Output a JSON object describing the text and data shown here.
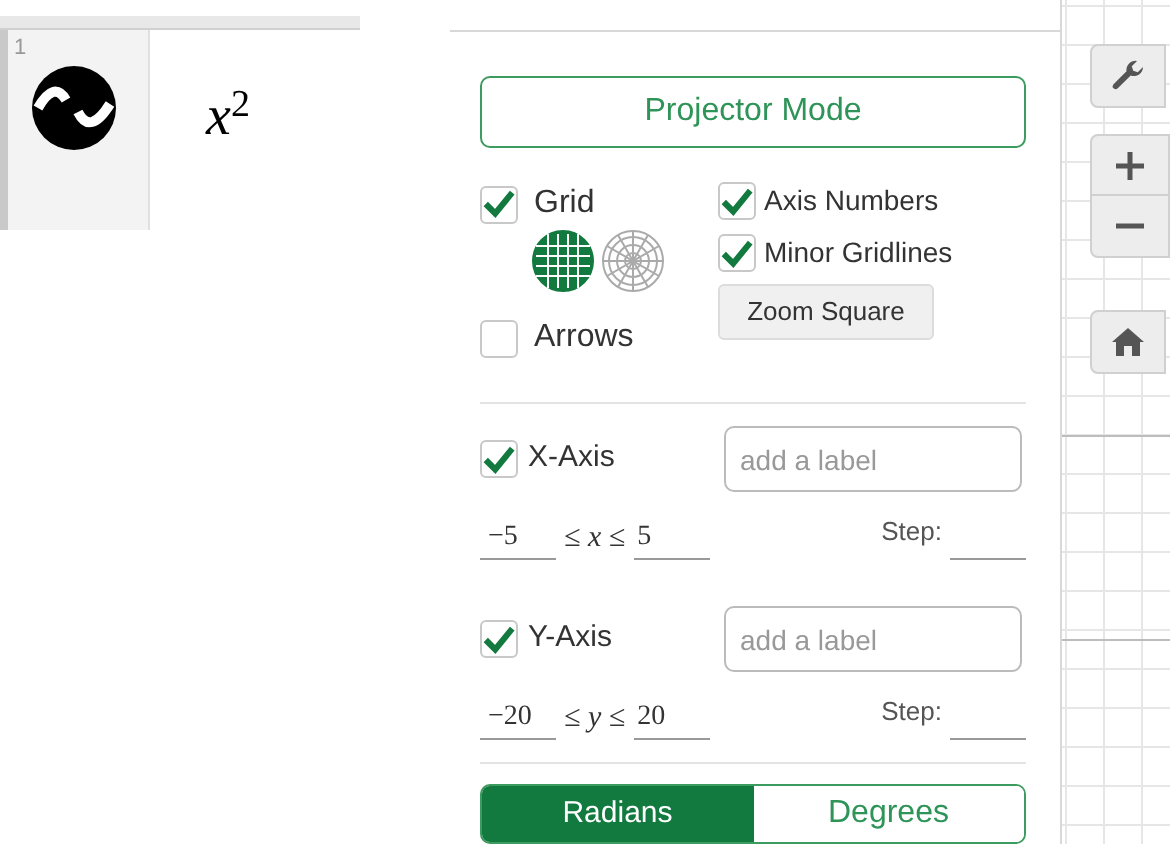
{
  "expression_list": {
    "rows": [
      {
        "index": "1",
        "expression": "x",
        "exponent": "2"
      }
    ]
  },
  "settings": {
    "projector_button": "Projector Mode",
    "grid": {
      "label": "Grid",
      "checked": true
    },
    "grid_types": [
      {
        "kind": "cartesian",
        "selected": true
      },
      {
        "kind": "polar",
        "selected": false
      }
    ],
    "arrows": {
      "label": "Arrows",
      "checked": false
    },
    "axis_numbers": {
      "label": "Axis Numbers",
      "checked": true
    },
    "minor_gridlines": {
      "label": "Minor Gridlines",
      "checked": true
    },
    "zoom_square": "Zoom Square",
    "axes": [
      {
        "label": "X-Axis",
        "checked": true,
        "placeholder": "add a label",
        "min": "−5",
        "relation": "≤ x ≤",
        "max": "5",
        "step_label": "Step:"
      },
      {
        "label": "Y-Axis",
        "checked": true,
        "placeholder": "add a label",
        "min": "−20",
        "relation": "≤ y ≤",
        "max": "20",
        "step_label": "Step:"
      }
    ],
    "units": [
      {
        "label": "Radians",
        "selected": true
      },
      {
        "label": "Degrees",
        "selected": false
      }
    ]
  }
}
